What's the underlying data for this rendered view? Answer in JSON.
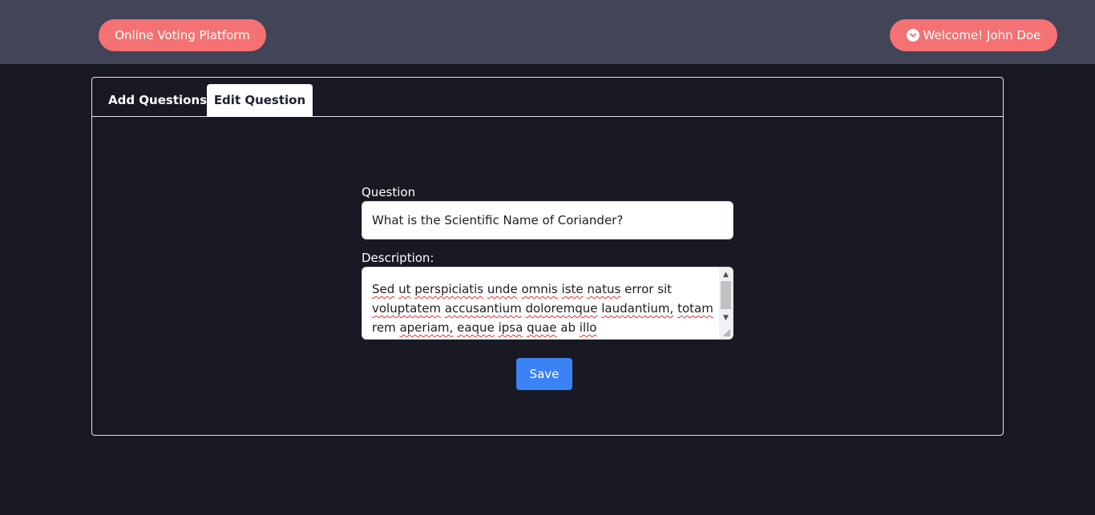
{
  "navbar": {
    "brand_label": "Online Voting Platform",
    "user_label": "Welcome! John Doe",
    "user_icon": "chevron-down-circle-icon"
  },
  "tabs": [
    {
      "label": "Add Questions",
      "active": false
    },
    {
      "label": "Edit Question",
      "active": true
    }
  ],
  "form": {
    "question_label": "Question",
    "question_value": "What is the Scientific Name of Coriander?",
    "description_label": "Description:",
    "description_words": [
      "Sed",
      "ut",
      "perspiciatis",
      "unde",
      "omnis",
      "iste",
      "natus",
      "error",
      "sit",
      "voluptatem",
      "accusantium",
      "doloremque",
      "laudantium,",
      "totam",
      "rem",
      "aperiam,",
      "eaque",
      "ipsa",
      "quae",
      "ab",
      "illo"
    ],
    "save_label": "Save"
  },
  "colors": {
    "navbar_bg": "#424458",
    "page_bg": "#181922",
    "pill_bg": "#f47274",
    "save_bg": "#3b82f6"
  }
}
